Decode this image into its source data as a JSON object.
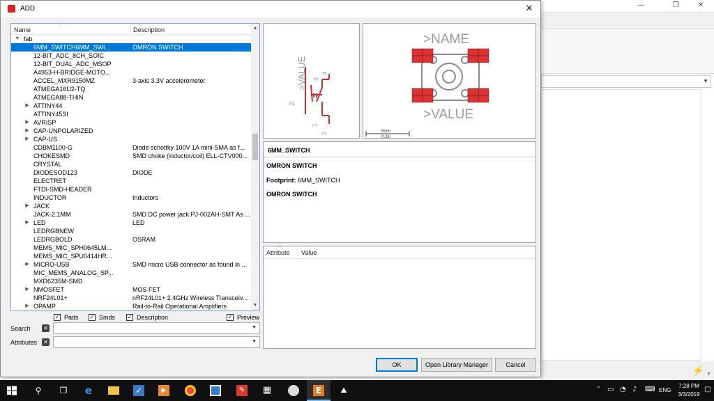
{
  "dialog": {
    "title": "ADD",
    "icon_text": "EAGLE",
    "close_glyph": "✕"
  },
  "tree": {
    "columns": [
      "Name",
      "Description"
    ],
    "rows": [
      {
        "name": "fab",
        "desc": "",
        "level": 0,
        "toggle": "▼"
      },
      {
        "name": "6MM_SWITCH6MM_SWI...",
        "desc": "OMRON SWITCH",
        "level": 1,
        "toggle": "",
        "selected": true
      },
      {
        "name": "12-BIT_ADC_8CH_SOIC",
        "desc": "",
        "level": 1,
        "toggle": ""
      },
      {
        "name": "12-BIT_DUAL_ADC_MSOP",
        "desc": "",
        "level": 1,
        "toggle": ""
      },
      {
        "name": "A4953-H-BRIDGE-MOTO...",
        "desc": "",
        "level": 1,
        "toggle": ""
      },
      {
        "name": "ACCEL_MXR9150MZ",
        "desc": "3-axis 3.3V accelerometer",
        "level": 1,
        "toggle": ""
      },
      {
        "name": "ATMEGA16U2-TQ",
        "desc": "",
        "level": 1,
        "toggle": ""
      },
      {
        "name": "ATMEGA88-THIN",
        "desc": "",
        "level": 1,
        "toggle": ""
      },
      {
        "name": "ATTINY44",
        "desc": "",
        "level": 1,
        "toggle": "▶"
      },
      {
        "name": "ATTINY45SI",
        "desc": "",
        "level": 1,
        "toggle": ""
      },
      {
        "name": "AVRISP",
        "desc": "",
        "level": 1,
        "toggle": "▶"
      },
      {
        "name": "CAP-UNPOLARIZED",
        "desc": "",
        "level": 1,
        "toggle": "▶"
      },
      {
        "name": "CAP-US",
        "desc": "",
        "level": 1,
        "toggle": "▶"
      },
      {
        "name": "CDBM1100-G",
        "desc": "Diode schottky 100V 1A mini-SMA as f...",
        "level": 1,
        "toggle": ""
      },
      {
        "name": "CHOKESMD",
        "desc": "SMD choke (inductor/coil) ELL-CTV000...",
        "level": 1,
        "toggle": ""
      },
      {
        "name": "CRYSTAL",
        "desc": "",
        "level": 1,
        "toggle": ""
      },
      {
        "name": "DIODESOD123",
        "desc": "DIODE",
        "level": 1,
        "toggle": ""
      },
      {
        "name": "ELECTRET",
        "desc": "",
        "level": 1,
        "toggle": ""
      },
      {
        "name": "FTDI-SMD-HEADER",
        "desc": "",
        "level": 1,
        "toggle": ""
      },
      {
        "name": "INDUCTOR",
        "desc": "Inductors",
        "level": 1,
        "toggle": ""
      },
      {
        "name": "JACK",
        "desc": "",
        "level": 1,
        "toggle": "▶"
      },
      {
        "name": "JACK-2.1MM",
        "desc": "SMD DC power jack PJ-002AH-SMT As ...",
        "level": 1,
        "toggle": ""
      },
      {
        "name": "LED",
        "desc": "LED",
        "level": 1,
        "toggle": "▶"
      },
      {
        "name": "LEDRGBNEW",
        "desc": "",
        "level": 1,
        "toggle": ""
      },
      {
        "name": "LEDRGBOLD",
        "desc": "OSRAM",
        "level": 1,
        "toggle": ""
      },
      {
        "name": "MEMS_MIC_SPH0645LM...",
        "desc": "",
        "level": 1,
        "toggle": ""
      },
      {
        "name": "MEMS_MIC_SPU0414HR...",
        "desc": "",
        "level": 1,
        "toggle": ""
      },
      {
        "name": "MICRO-USB",
        "desc": "SMD micro USB connector as found in ...",
        "level": 1,
        "toggle": "▶"
      },
      {
        "name": "MIC_MEMS_ANALOG_SP...",
        "desc": "",
        "level": 1,
        "toggle": ""
      },
      {
        "name": "MXD6235M-SMD",
        "desc": "",
        "level": 1,
        "toggle": ""
      },
      {
        "name": "NMOSFET",
        "desc": "MOS FET",
        "level": 1,
        "toggle": "▶"
      },
      {
        "name": "NRF24L01+",
        "desc": "nRF24L01+ 2.4GHz Wireless Transceiv...",
        "level": 1,
        "toggle": ""
      },
      {
        "name": "OPAMP",
        "desc": "Rail-to-Rail Operational Amplifiers",
        "level": 1,
        "toggle": "▶"
      }
    ]
  },
  "filters": {
    "pads": "Pads",
    "smds": "Smds",
    "description": "Description",
    "preview": "Preview",
    "check_glyph": "✓"
  },
  "search": {
    "label": "Search",
    "value": ""
  },
  "attributes_filter": {
    "label": "Attributes",
    "value": ""
  },
  "symbol_preview": {
    "value_label": ">VALUE",
    "pin_labels": [
      "2",
      "1",
      "3",
      "4",
      "2"
    ]
  },
  "package_preview": {
    "name_label": ">NAME",
    "value_label": ">VALUE",
    "scale_top": "5mm",
    "scale_bottom": "0.2in"
  },
  "description": {
    "title": "6MM_SWITCH",
    "line1": "OMRON SWITCH",
    "footprint_label": "Footprint:",
    "footprint_value": "6MM_SWITCH",
    "line2": "OMRON SWITCH"
  },
  "attributes": {
    "columns": [
      "Attribute",
      "Value"
    ]
  },
  "buttons": {
    "ok": "OK",
    "open_library_manager": "Open Library Manager",
    "cancel": "Cancel"
  },
  "bg_window": {
    "minimize": "—",
    "maximize": "❐",
    "close": "✕"
  },
  "taskbar": {
    "time": "7:28 PM",
    "date": "3/3/2019",
    "lang": "ENG"
  },
  "colors": {
    "selection": "#0078d7",
    "pad_red": "#e03030",
    "symbol_red": "#c83232",
    "text_gray": "#9a9a9a"
  }
}
